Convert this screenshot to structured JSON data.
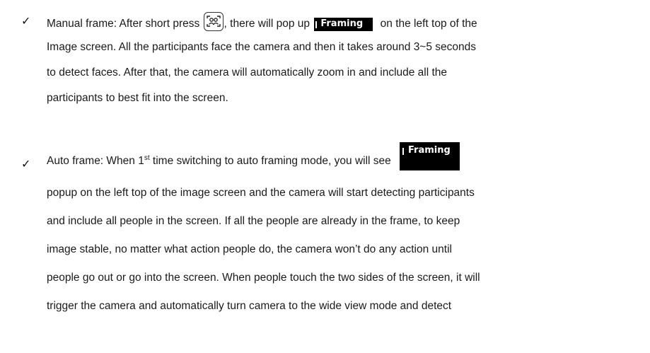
{
  "items": [
    {
      "lines": [
        {
          "before": "Manual frame: After short press ",
          "mid": ", there will pop up ",
          "after": " on the left top of the"
        },
        "Image screen. All the participants face the camera and then it takes around 3~5 seconds",
        "to detect faces. After that, the camera will automatically zoom in and include all the",
        "participants to best fit into the screen."
      ]
    },
    {
      "lines": [
        {
          "before": "Auto frame: When 1",
          "sup": "st",
          "after": " time switching to auto framing mode, you will see"
        },
        "popup on the left top of the image screen and the camera will start detecting participants",
        "and include all people in the screen. If all the people are already in the frame, to keep",
        "image stable, no matter what action people do, the camera won’t do any action until",
        "people go out or go into the screen. When people touch the two sides of the screen, it will",
        "trigger the camera and automatically turn camera to the wide view mode and detect"
      ]
    }
  ],
  "check_mark": "✓",
  "badge_label": "Framing",
  "icons": [
    "auto-framing-button-icon"
  ]
}
